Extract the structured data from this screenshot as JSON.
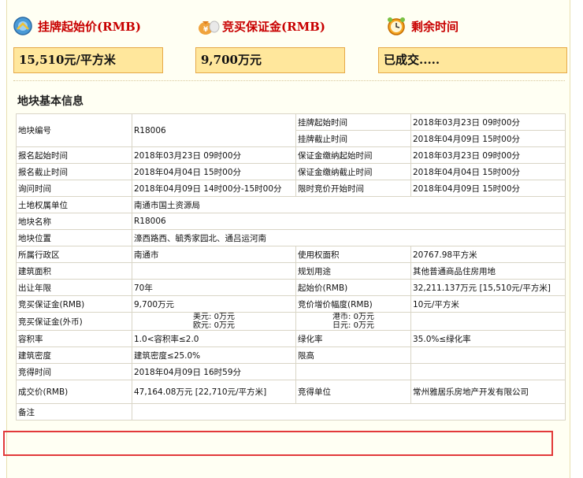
{
  "header": {
    "start_price_label": "挂牌起始价(RMB)",
    "deposit_label": "竞买保证金(RMB)",
    "remaining_label": "剩余时间"
  },
  "values": {
    "start_price": "15,510元/平方米",
    "deposit": "9,700万元",
    "remaining": "已成交....."
  },
  "section_title": "地块基本信息",
  "fields": {
    "parcel_no_label": "地块编号",
    "parcel_no": "R18006",
    "list_start_label": "挂牌起始时间",
    "list_start": "2018年03月23日 09时00分",
    "list_end_label": "挂牌截止时间",
    "list_end": "2018年04月09日 15时00分",
    "reg_start_label": "报名起始时间",
    "reg_start": "2018年03月23日 09时00分",
    "dep_start_label": "保证金缴纳起始时间",
    "dep_start": "2018年03月23日 09时00分",
    "reg_end_label": "报名截止时间",
    "reg_end": "2018年04月04日 15时00分",
    "dep_end_label": "保证金缴纳截止时间",
    "dep_end": "2018年04月04日 15时00分",
    "inquiry_label": "询问时间",
    "inquiry": "2018年04月09日 14时00分-15时00分",
    "timed_label": "限时竞价开始时间",
    "timed": "2018年04月09日 15时00分",
    "owner_label": "土地权属单位",
    "owner": "南通市国土资源局",
    "name_label": "地块名称",
    "name": "R18006",
    "location_label": "地块位置",
    "location": "濠西路西、毓秀家园北、通吕运河南",
    "district_label": "所属行政区",
    "district": "南通市",
    "use_area_label": "使用权面积",
    "use_area": "20767.98平方米",
    "build_area_label": "建筑面积",
    "build_area": "",
    "purpose_label": "规划用途",
    "purpose": "其他普通商品住房用地",
    "years_label": "出让年限",
    "years": "70年",
    "start_price_label": "起始价(RMB)",
    "start_price": "32,211.137万元 [15,510元/平方米]",
    "deposit_rmb_label": "竞买保证金(RMB)",
    "deposit_rmb": "9,700万元",
    "increment_label": "竞价增价幅度(RMB)",
    "increment": "10元/平方米",
    "deposit_fx_label": "竞买保证金(外币)",
    "usd": "美元: 0万元",
    "eur": "欧元: 0万元",
    "hkd": "港币: 0万元",
    "jpy": "日元: 0万元",
    "far_label": "容积率",
    "far": "1.0<容积率≤2.0",
    "green_label": "绿化率",
    "green": "35.0%≤绿化率",
    "density_label": "建筑密度",
    "density": "建筑密度≤25.0%",
    "height_label": "限高",
    "height": "",
    "won_time_label": "竞得时间",
    "won_time": "2018年04月09日 16时59分",
    "deal_price_label": "成交价(RMB)",
    "deal_price": "47,164.08万元 [22,710元/平方米]",
    "winner_label": "竞得单位",
    "winner": "常州雅居乐房地产开发有限公司",
    "remark_label": "备注",
    "remark": ""
  },
  "colors": {
    "accent_red": "#c80000",
    "box_fill": "#ffe79c",
    "box_border": "#e6a948",
    "highlight": "#e23a3a"
  },
  "icons": [
    "price-tag-icon",
    "money-bag-icon",
    "alarm-clock-icon"
  ]
}
